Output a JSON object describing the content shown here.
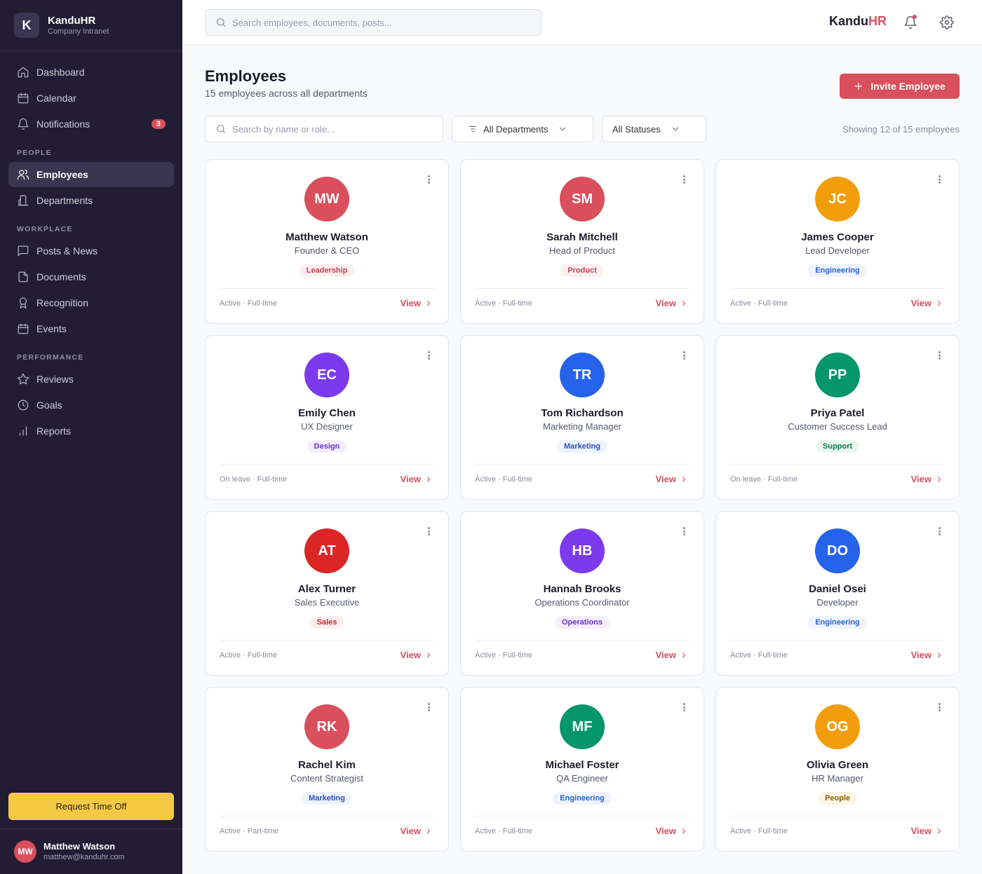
{
  "app": {
    "name": "KanduHR",
    "subtitle": "Company Intranet",
    "logo_letter": "K",
    "brand_part1": "Kandu",
    "brand_part2": "HR"
  },
  "topbar": {
    "search_placeholder": "Search employees, documents, posts..."
  },
  "sidebar": {
    "main_items": [
      {
        "label": "Dashboard",
        "icon": "home-icon"
      },
      {
        "label": "Calendar",
        "icon": "calendar-icon"
      },
      {
        "label": "Notifications",
        "icon": "bell-icon",
        "badge": "3"
      }
    ],
    "sections": [
      {
        "title": "PEOPLE",
        "items": [
          {
            "label": "Employees",
            "icon": "users-icon",
            "active": true
          },
          {
            "label": "Departments",
            "icon": "building-icon"
          }
        ]
      },
      {
        "title": "WORKPLACE",
        "items": [
          {
            "label": "Posts & News",
            "icon": "message-icon"
          },
          {
            "label": "Documents",
            "icon": "file-icon"
          },
          {
            "label": "Recognition",
            "icon": "award-icon"
          },
          {
            "label": "Events",
            "icon": "calendar-icon"
          }
        ]
      },
      {
        "title": "PERFORMANCE",
        "items": [
          {
            "label": "Reviews",
            "icon": "star-icon"
          },
          {
            "label": "Goals",
            "icon": "clock-icon"
          },
          {
            "label": "Reports",
            "icon": "bar-chart-icon"
          }
        ]
      }
    ],
    "time_off_button": "Request Time Off",
    "user": {
      "initials": "MW",
      "name": "Matthew Watson",
      "email": "matthew@kanduhr.com"
    }
  },
  "page": {
    "title": "Employees",
    "subtitle": "15 employees across all departments",
    "invite_button": "Invite Employee",
    "filter_search_placeholder": "Search by name or role...",
    "department_filter": "All Departments",
    "status_filter": "All Statuses",
    "showing_text": "Showing 12 of 15 employees"
  },
  "card_view_label": "View",
  "employees": [
    {
      "initials": "MW",
      "name": "Matthew Watson",
      "role": "Founder & CEO",
      "department": "Leadership",
      "status": "Active · Full-time",
      "avatar_color": "#d94f5c",
      "tag_bg": "#fdeef0",
      "tag_fg": "#c2414f"
    },
    {
      "initials": "SM",
      "name": "Sarah Mitchell",
      "role": "Head of Product",
      "department": "Product",
      "status": "Active · Full-time",
      "avatar_color": "#d94f5c",
      "tag_bg": "#fdeef0",
      "tag_fg": "#c2414f"
    },
    {
      "initials": "JC",
      "name": "James Cooper",
      "role": "Lead Developer",
      "department": "Engineering",
      "status": "Active · Full-time",
      "avatar_color": "#f29e0c",
      "tag_bg": "#eef3fd",
      "tag_fg": "#2a62d6"
    },
    {
      "initials": "EC",
      "name": "Emily Chen",
      "role": "UX Designer",
      "department": "Design",
      "status": "On leave · Full-time",
      "avatar_color": "#7c3aed",
      "tag_bg": "#f3eefd",
      "tag_fg": "#6d2fd6"
    },
    {
      "initials": "TR",
      "name": "Tom Richardson",
      "role": "Marketing Manager",
      "department": "Marketing",
      "status": "Active · Full-time",
      "avatar_color": "#2563eb",
      "tag_bg": "#eef3fd",
      "tag_fg": "#2a4fbf"
    },
    {
      "initials": "PP",
      "name": "Priya Patel",
      "role": "Customer Success Lead",
      "department": "Support",
      "status": "On leave · Full-time",
      "avatar_color": "#059669",
      "tag_bg": "#eaf8f1",
      "tag_fg": "#0b7a4f"
    },
    {
      "initials": "AT",
      "name": "Alex Turner",
      "role": "Sales Executive",
      "department": "Sales",
      "status": "Active · Full-time",
      "avatar_color": "#dc2626",
      "tag_bg": "#fdeeee",
      "tag_fg": "#c22b2b"
    },
    {
      "initials": "HB",
      "name": "Hannah Brooks",
      "role": "Operations Coordinator",
      "department": "Operations",
      "status": "Active · Full-time",
      "avatar_color": "#7c3aed",
      "tag_bg": "#f3eefd",
      "tag_fg": "#6d2fd6"
    },
    {
      "initials": "DO",
      "name": "Daniel Osei",
      "role": "Developer",
      "department": "Engineering",
      "status": "Active · Full-time",
      "avatar_color": "#2563eb",
      "tag_bg": "#eef3fd",
      "tag_fg": "#2a62d6"
    },
    {
      "initials": "RK",
      "name": "Rachel Kim",
      "role": "Content Strategist",
      "department": "Marketing",
      "status": "Active · Part-time",
      "avatar_color": "#d94f5c",
      "tag_bg": "#eef3fd",
      "tag_fg": "#2a4fbf"
    },
    {
      "initials": "MF",
      "name": "Michael Foster",
      "role": "QA Engineer",
      "department": "Engineering",
      "status": "Active · Full-time",
      "avatar_color": "#059669",
      "tag_bg": "#eef3fd",
      "tag_fg": "#2a62d6"
    },
    {
      "initials": "OG",
      "name": "Olivia Green",
      "role": "HR Manager",
      "department": "People",
      "status": "Active · Full-time",
      "avatar_color": "#f29e0c",
      "tag_bg": "#fdf6e6",
      "tag_fg": "#8a5a07"
    }
  ]
}
